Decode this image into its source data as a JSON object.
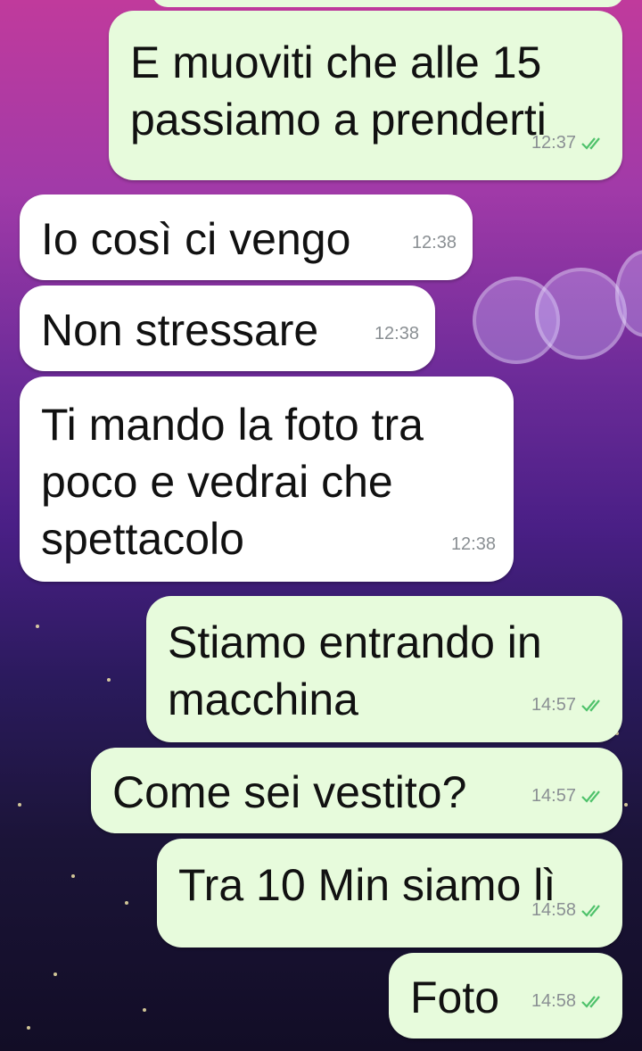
{
  "messages": [
    {
      "text": "E muoviti che alle 15\npassiamo a prenderti",
      "time": "12:37",
      "dir": "out"
    },
    {
      "text": "Io così ci vengo",
      "time": "12:38",
      "dir": "in"
    },
    {
      "text": "Non stressare",
      "time": "12:38",
      "dir": "in"
    },
    {
      "text": "Ti mando la foto tra\npoco e vedrai che\nspettacolo",
      "time": "12:38",
      "dir": "in"
    },
    {
      "text": "Stiamo entrando in\nmacchina",
      "time": "14:57",
      "dir": "out"
    },
    {
      "text": "Come sei vestito?",
      "time": "14:57",
      "dir": "out"
    },
    {
      "text": "Tra 10 Min siamo lì",
      "time": "14:58",
      "dir": "out"
    },
    {
      "text": "Foto",
      "time": "14:58",
      "dir": "out"
    }
  ],
  "colors": {
    "outgoing_bubble": "#e7fbdc",
    "incoming_bubble": "#ffffff",
    "read_ticks": "#4fc26b"
  }
}
